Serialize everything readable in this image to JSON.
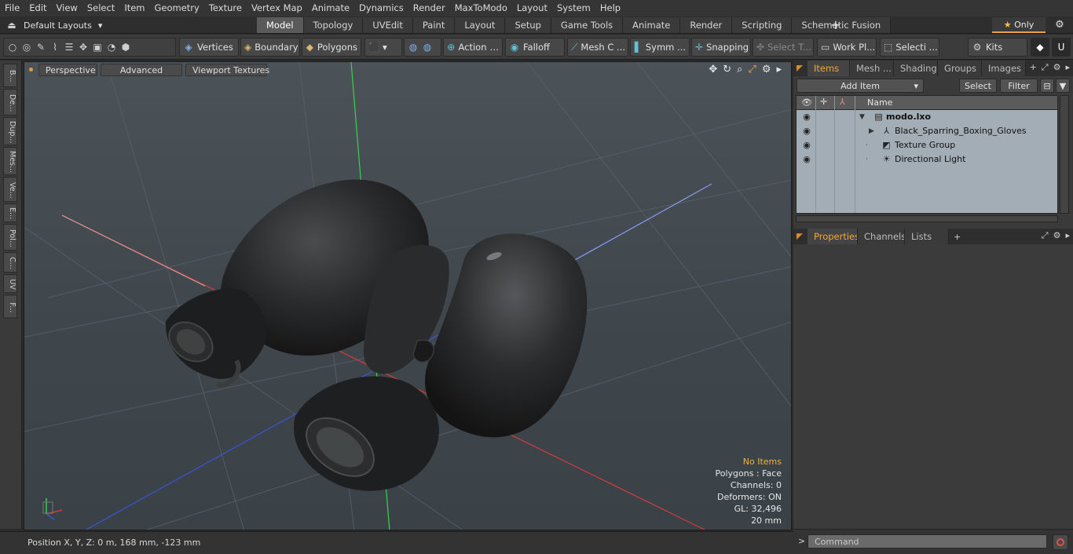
{
  "menu": [
    "File",
    "Edit",
    "View",
    "Select",
    "Item",
    "Geometry",
    "Texture",
    "Vertex Map",
    "Animate",
    "Dynamics",
    "Render",
    "MaxToModo",
    "Layout",
    "System",
    "Help"
  ],
  "layouts_label": "Default Layouts",
  "layout_tabs": [
    {
      "label": "Model",
      "active": true
    },
    {
      "label": "Topology",
      "active": false
    },
    {
      "label": "UVEdit",
      "active": false
    },
    {
      "label": "Paint",
      "active": false
    },
    {
      "label": "Layout",
      "active": false
    },
    {
      "label": "Setup",
      "active": false
    },
    {
      "label": "Game Tools",
      "active": false
    },
    {
      "label": "Animate",
      "active": false
    },
    {
      "label": "Render",
      "active": false
    },
    {
      "label": "Scripting",
      "active": false
    },
    {
      "label": "Schematic Fusion",
      "active": false
    }
  ],
  "only_label": "Only",
  "toolbar": {
    "vertices": "Vertices",
    "boundary": "Boundary",
    "polygons": "Polygons",
    "action": "Action",
    "falloff": "Falloff",
    "mesh": "Mesh C ...",
    "symm": "Symm ...",
    "snapping": "Snapping",
    "select_t": "Select T...",
    "work_plane": "Work Pl...",
    "selecti": "Selecti ...",
    "kits": "Kits"
  },
  "left_strip": [
    "B...",
    "De...",
    "Dup...",
    "Mes...",
    "Ve...",
    "E...",
    "Pol...",
    "C...",
    "UV",
    "F..."
  ],
  "viewport": {
    "perspective": "Perspective",
    "advanced": "Advanced",
    "textures": "Viewport Textures",
    "info": {
      "no_items": "No Items",
      "polygons": "Polygons : Face",
      "channels": "Channels: 0",
      "deformers": "Deformers: ON",
      "gl": "GL: 32,496",
      "scale": "20 mm"
    }
  },
  "status": {
    "position": "Position X, Y, Z:   0 m, 168 mm, -123 mm"
  },
  "panel_top": {
    "tabs": [
      "Items",
      "Mesh ...",
      "Shading",
      "Groups",
      "Images"
    ],
    "add_item": "Add Item",
    "select": "Select",
    "filter": "Filter",
    "name_header": "Name",
    "rows": [
      {
        "label": "modo.lxo",
        "level": 0
      },
      {
        "label": "Black_Sparring_Boxing_Gloves",
        "level": 1
      },
      {
        "label": "Texture Group",
        "level": 1
      },
      {
        "label": "Directional Light",
        "level": 1
      }
    ]
  },
  "panel_bottom": {
    "tabs": [
      "Properties",
      "Channels",
      "Lists"
    ]
  },
  "command_placeholder": "Command",
  "colors": {
    "accent": "#f0a73c",
    "x_axis": "#d83a3a",
    "y_axis": "#3bd24a",
    "z_axis": "#3a54d8"
  }
}
